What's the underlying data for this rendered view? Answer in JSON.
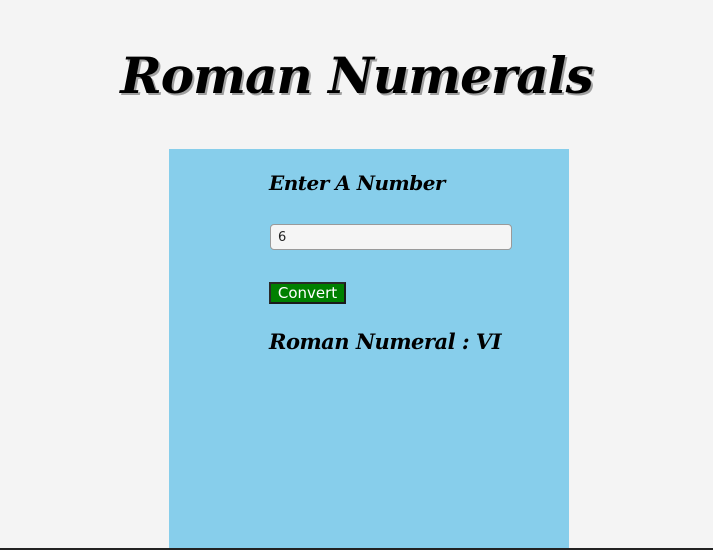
{
  "header": {
    "title": "Roman Numerals"
  },
  "form": {
    "label": "Enter A Number",
    "input_value": "6",
    "button_label": "Convert"
  },
  "result": {
    "text": "Roman Numeral : VI"
  },
  "colors": {
    "page_background": "#f4f4f4",
    "card_background": "#87ceeb",
    "button_background": "#008000"
  }
}
